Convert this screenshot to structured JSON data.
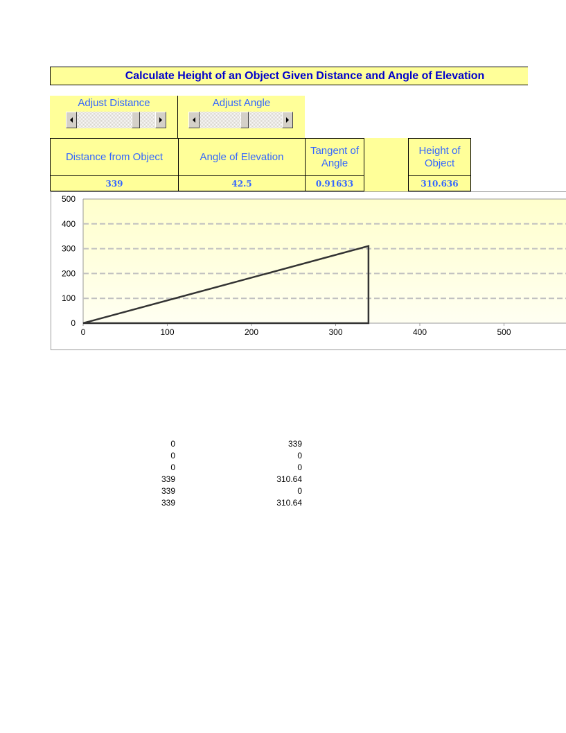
{
  "title": "Calculate Height of an Object Given Distance and Angle of Elevation",
  "controls": {
    "distance": {
      "label": "Adjust Distance",
      "value_fraction": 0.78
    },
    "angle": {
      "label": "Adjust Angle",
      "value_fraction": 0.55
    }
  },
  "table": {
    "headers": {
      "distance": "Distance from Object",
      "angle": "Angle of Elevation",
      "tangent_line1": "Tangent of",
      "tangent_line2": "Angle",
      "height_line1": "Height of",
      "height_line2": "Object"
    },
    "values": {
      "distance": "339",
      "angle": "42.5",
      "tangent": "0.91633",
      "height": "310.636"
    }
  },
  "chart_data": {
    "type": "scatter",
    "title": "",
    "xlabel": "",
    "ylabel": "",
    "xlim": [
      0,
      500
    ],
    "ylim": [
      0,
      500
    ],
    "x_ticks": [
      "0",
      "100",
      "200",
      "300",
      "400",
      "500"
    ],
    "y_ticks": [
      "0",
      "100",
      "200",
      "300",
      "400",
      "500"
    ],
    "grid": "horizontal-dashed",
    "series": [
      {
        "name": "triangle",
        "points": [
          [
            0,
            0
          ],
          [
            339,
            0
          ],
          [
            339,
            310.64
          ],
          [
            0,
            0
          ]
        ]
      }
    ],
    "colors": {
      "line": "#333333",
      "grid": "#c0c0c0",
      "plot_bg_top": "#ffffcc",
      "plot_bg_bottom": "#fffff0"
    }
  },
  "data_rows": [
    [
      "0",
      "339"
    ],
    [
      "0",
      "0"
    ],
    [
      "0",
      "0"
    ],
    [
      "339",
      "310.64"
    ],
    [
      "339",
      "0"
    ],
    [
      "339",
      "310.64"
    ]
  ]
}
